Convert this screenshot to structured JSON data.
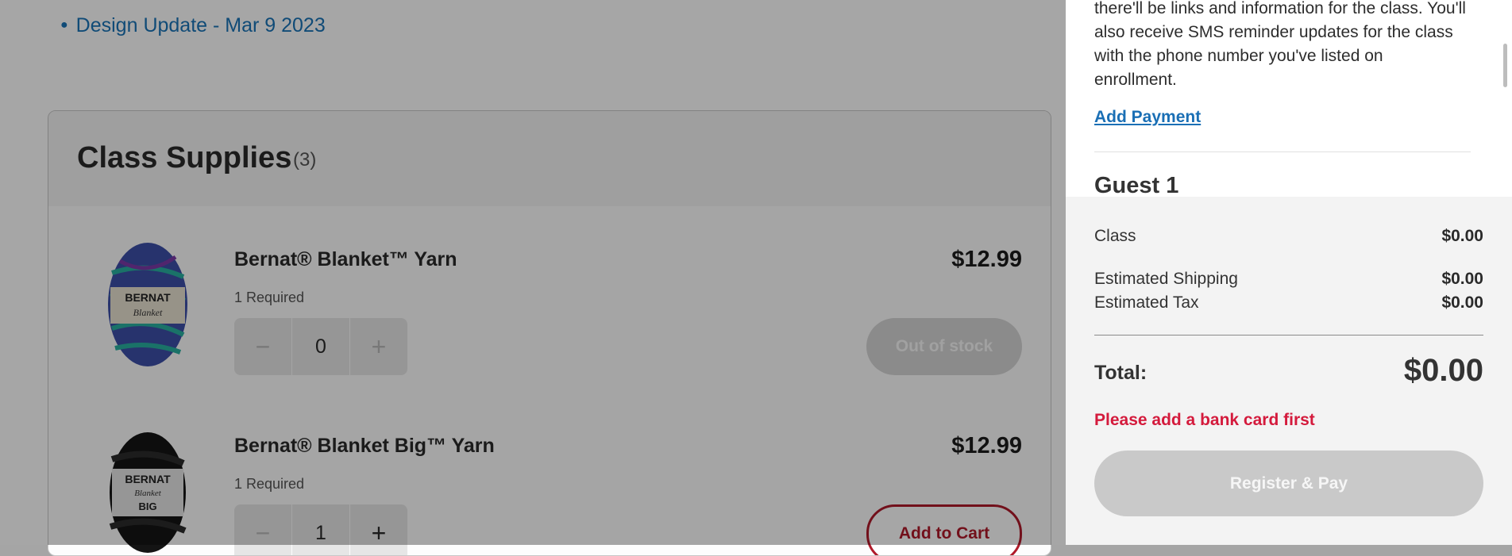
{
  "background": {
    "link_text": "Design Update - Mar 9 2023",
    "supplies": {
      "title": "Class Supplies",
      "count": "(3)",
      "items": [
        {
          "name": "Bernat® Blanket™ Yarn",
          "required": "1 Required",
          "price": "$12.99",
          "quantity": "0",
          "action": "Out of stock",
          "image_label": "BERNAT Blanket"
        },
        {
          "name": "Bernat® Blanket Big™ Yarn",
          "required": "1 Required",
          "price": "$12.99",
          "quantity": "1",
          "action": "Add to Cart",
          "image_label": "BERNAT Blanket BIG"
        }
      ]
    }
  },
  "panel": {
    "info_text": "there'll be links and information for the class. You'll also receive SMS reminder updates for the class with the phone number you've listed on enrollment.",
    "add_payment": "Add Payment",
    "guest_title": "Guest 1",
    "summary": {
      "rows": [
        {
          "label": "Class",
          "value": "$0.00"
        },
        {
          "label": "Estimated Shipping",
          "value": "$0.00"
        },
        {
          "label": "Estimated Tax",
          "value": "$0.00"
        }
      ],
      "total_label": "Total:",
      "total_value": "$0.00",
      "error": "Please add a bank card first",
      "pay_button": "Register & Pay"
    }
  },
  "colors": {
    "link": "#1a73b7",
    "error": "#d41a3c",
    "brand_red": "#b01a2a"
  }
}
